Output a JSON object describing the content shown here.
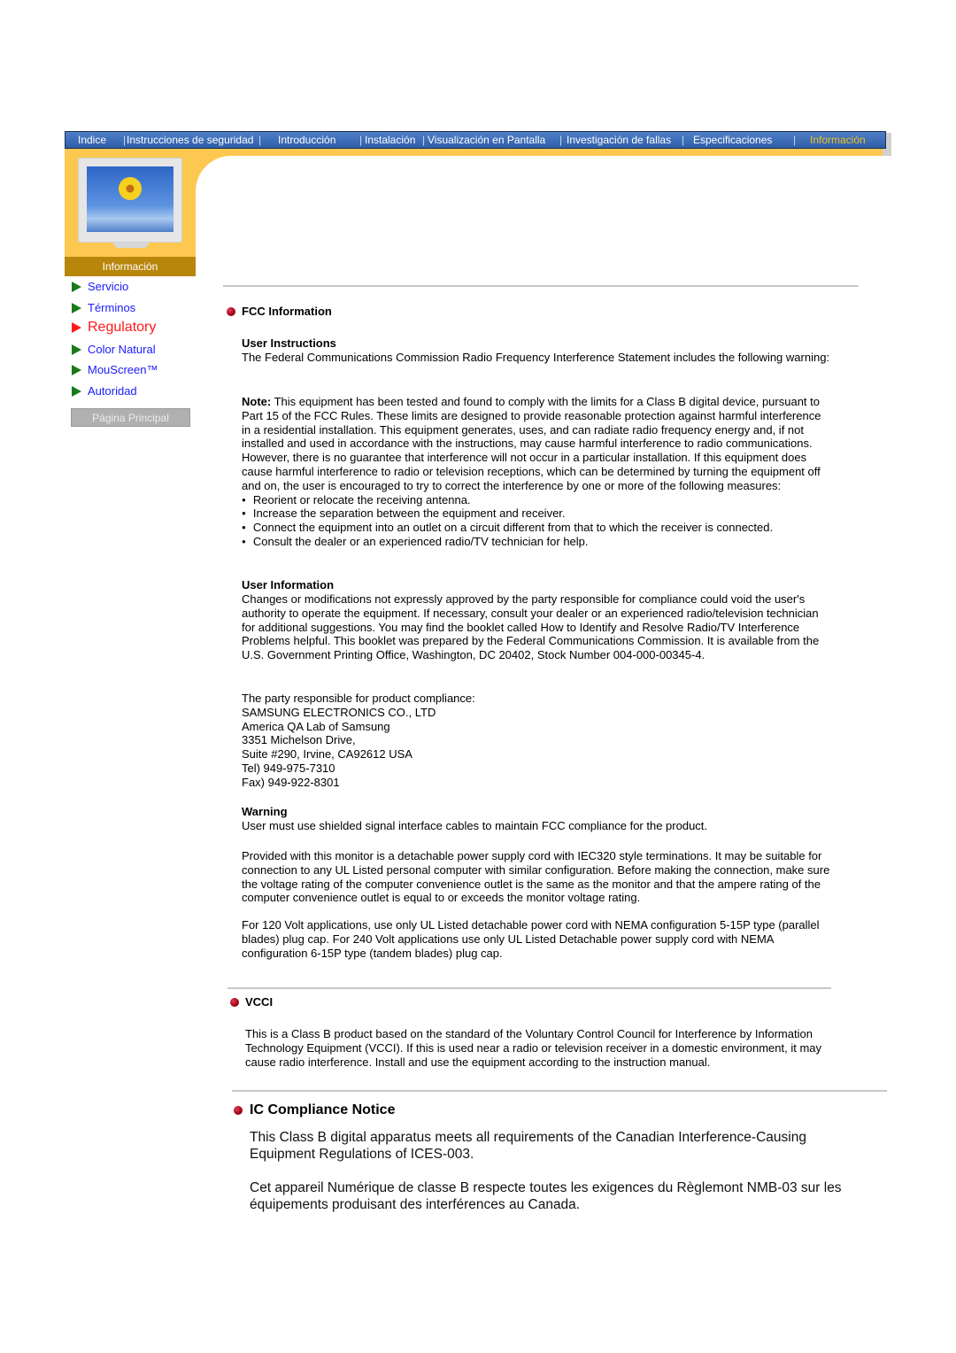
{
  "topnav": {
    "items": [
      {
        "label": "Indice",
        "active": false
      },
      {
        "label": "Instrucciones de seguridad",
        "active": false
      },
      {
        "label": "Introducción",
        "active": false
      },
      {
        "label": "Instalación",
        "active": false
      },
      {
        "label": "Visualización en Pantalla",
        "active": false
      },
      {
        "label": "Investigación de fallas",
        "active": false
      },
      {
        "label": "Especificaciones",
        "active": false
      },
      {
        "label": "Información",
        "active": true
      }
    ],
    "separator": "|"
  },
  "sidebar": {
    "section_label": "Información",
    "items": [
      {
        "label": "Servicio",
        "active": false
      },
      {
        "label": "Términos",
        "active": false
      },
      {
        "label": "Regulatory",
        "active": true
      },
      {
        "label": "Color Natural",
        "active": false
      },
      {
        "label": "MouScreen™",
        "active": false
      },
      {
        "label": "Autoridad",
        "active": false
      }
    ],
    "home_button": "Página Principal"
  },
  "colors": {
    "nav_bg": "#3b6bb8",
    "nav_active": "#f0c020",
    "orange": "#fcc850",
    "section_label_bg": "#b8860b",
    "link": "#1a1aff",
    "active_link": "#ff1a1a",
    "bullet": "#a00018"
  },
  "fcc": {
    "title": "FCC Information",
    "user_instructions": {
      "heading": "User Instructions",
      "text": "The Federal Communications Commission Radio Frequency Interference Statement includes the following warning:"
    },
    "note": {
      "label": "Note:",
      "text": " This equipment has been tested and found to comply with the limits for a Class B digital device, pursuant to Part 15 of the FCC Rules. These limits are designed to provide reasonable protection against harmful interference in a residential installation. This equipment generates, uses, and can radiate radio frequency energy and, if not installed and used in accordance with the instructions, may cause harmful interference to radio communications. However, there is no guarantee that interference will not occur in a particular installation. If this equipment does cause harmful interference to radio or television receptions, which can be determined by turning the equipment off and on, the user is encouraged to try to correct the interference by one or more of the following measures:",
      "measures": [
        "Reorient or relocate the receiving antenna.",
        "Increase the separation between the equipment and receiver.",
        "Connect the equipment into an outlet on a circuit different from that to which the receiver is connected.",
        "Consult the dealer or an experienced radio/TV technician for help."
      ]
    },
    "user_information": {
      "heading": "User Information",
      "text": "Changes or modifications not expressly approved by the party responsible for compliance could void the user's authority to operate the equipment. If necessary, consult your dealer or an experienced radio/television technician for additional suggestions. You may find the booklet called How to Identify and Resolve Radio/TV Interference Problems helpful. This booklet was prepared by the Federal Communications Commission. It is available from the U.S. Government Printing Office, Washington, DC 20402, Stock Number 004-000-00345-4."
    },
    "responsible_party": {
      "intro": "The party responsible for product compliance:",
      "lines": [
        "SAMSUNG ELECTRONICS CO., LTD",
        "America QA Lab of Samsung",
        "3351 Michelson Drive,",
        "Suite #290, Irvine, CA92612 USA",
        "Tel) 949-975-7310",
        "Fax) 949-922-8301"
      ]
    },
    "warning": {
      "heading": "Warning",
      "text": "User must use shielded signal interface cables to maintain FCC compliance for the product."
    },
    "power_cord": {
      "text1": "Provided with this monitor is a detachable power supply cord with IEC320 style terminations. It may be suitable for connection to any UL Listed personal computer with similar configuration. Before making the connection, make sure the voltage rating of the computer convenience outlet is the same as the monitor and that the ampere rating of the computer convenience outlet is equal to or exceeds the monitor voltage rating.",
      "text2": "For 120 Volt applications, use only UL Listed detachable power cord with NEMA configuration 5-15P type (parallel blades) plug cap. For 240 Volt applications use only UL Listed Detachable power supply cord with NEMA configuration 6-15P type (tandem blades) plug cap."
    }
  },
  "vcci": {
    "title": "VCCI",
    "text": "This is a Class B product based on the standard of the Voluntary Control Council for Interference by Information Technology Equipment (VCCI). If this is used near a radio or television receiver in a domestic environment, it may cause radio interference. Install and use the equipment according to the instruction manual."
  },
  "ic": {
    "title": "IC Compliance Notice",
    "text_en": "This Class B digital apparatus meets all requirements of the Canadian Interference-Causing Equipment Regulations of ICES-003.",
    "text_fr": "Cet appareil Numérique de classe B respecte toutes les exigences du Règlemont NMB-03 sur les équipements produisant des interférences au Canada."
  }
}
